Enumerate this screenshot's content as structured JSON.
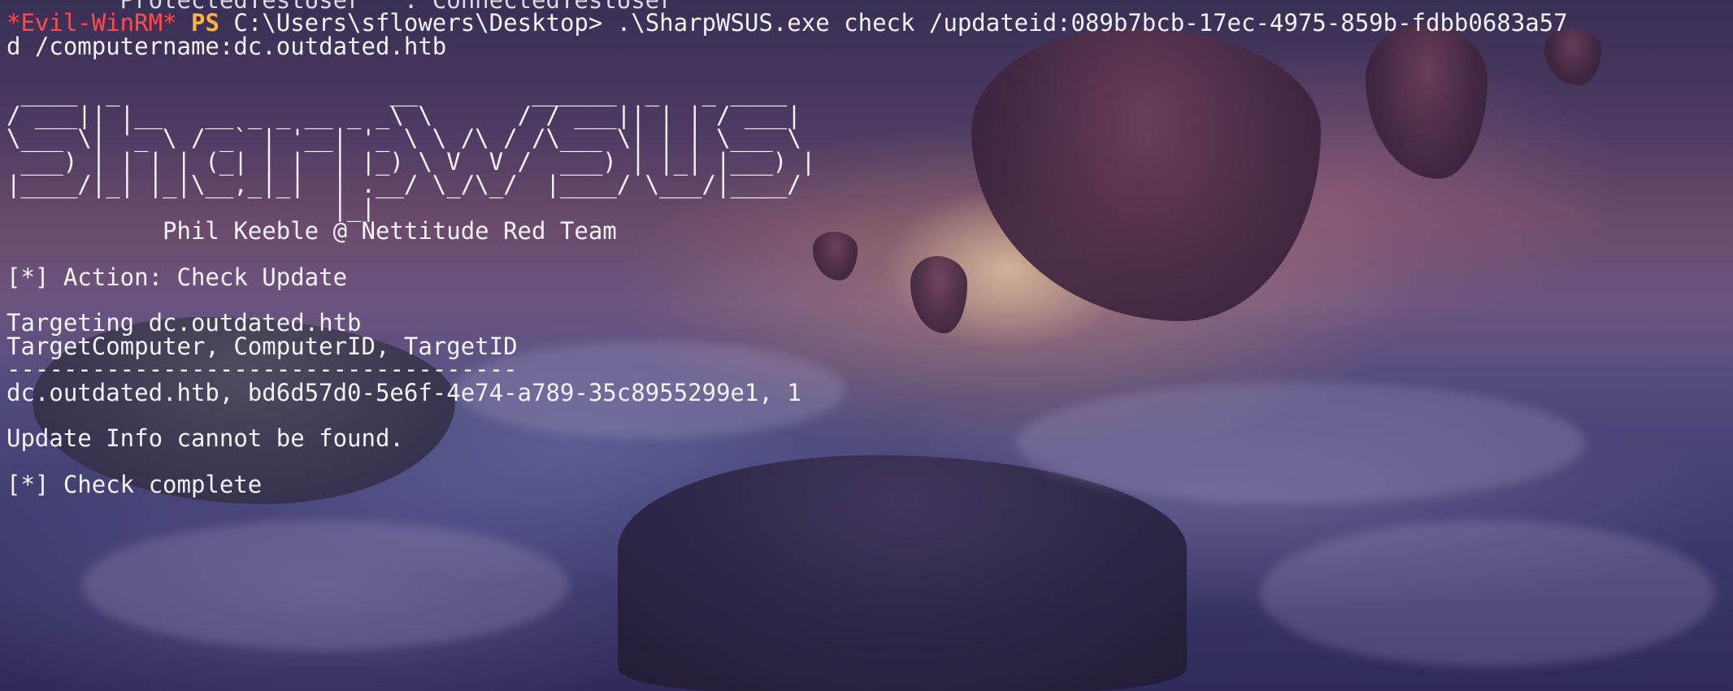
{
  "terminal": {
    "prev_line": "        ProtectedTestUser   : ConnectedTestUser",
    "prompt": {
      "evil": "*Evil-WinRM*",
      "ps": "PS",
      "path": "C:\\Users\\sflowers\\Desktop>",
      "command": ".\\SharpWSUS.exe check /updateid:089b7bcb-17ec-4975-859b-fdbb0683a57",
      "command_wrap": "d /computername:dc.outdated.htb"
    },
    "banner": [
      " ____  _                   __        ______  _   _ ____",
      "/ ___|| |__   __ _ _ __ _ _\\ \\      / / ___|| | | / ___|",
      "\\___ \\| '_ \\ / _` | '__| '_ \\ \\ /\\ / /\\___ \\| | | \\___ \\",
      " ___) | | | | (_| | |  | |_) \\ V  V /  ___) | |_| |___) |",
      "|____/|_| |_|\\__,_|_|  | .__/ \\_/\\_/  |____/ \\___/|____/",
      "                       |_|"
    ],
    "author": "           Phil Keeble @ Nettitude Red Team",
    "action": "[*] Action: Check Update",
    "targeting": "Targeting dc.outdated.htb",
    "columns": "TargetComputer, ComputerID, TargetID",
    "separator": "------------------------------------",
    "row": "dc.outdated.htb, bd6d57d0-5e6f-4e74-a789-35c8955299e1, 1",
    "info": "Update Info cannot be found.",
    "complete": "[*] Check complete"
  },
  "colors": {
    "prompt_red": "#ff4b4b",
    "prompt_orange": "#ffb347",
    "text": "#f4f1f5"
  }
}
